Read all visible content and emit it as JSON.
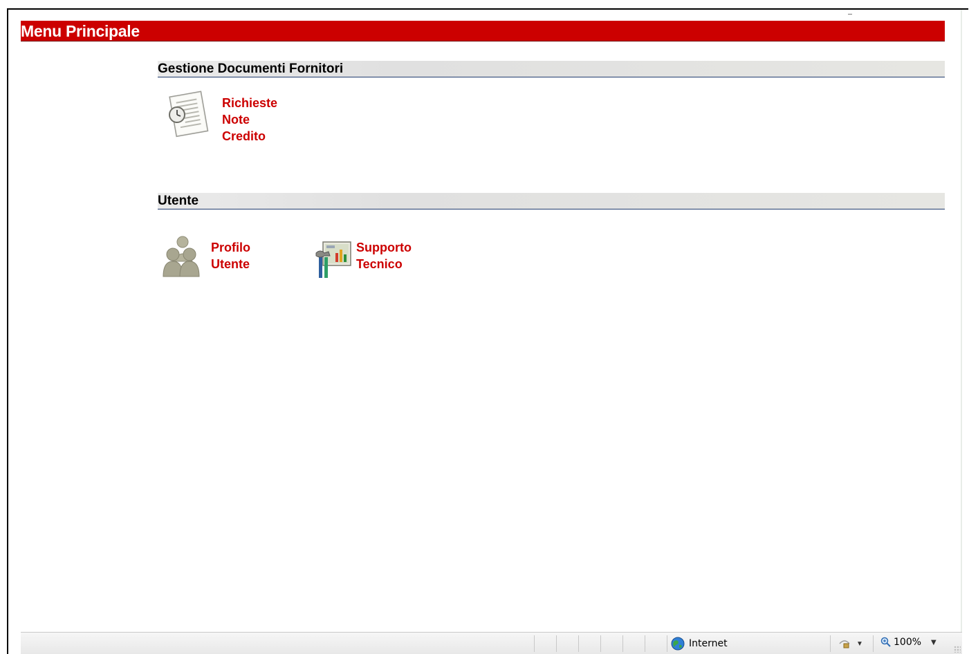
{
  "header": {
    "title": "Menu Principale"
  },
  "sections": [
    {
      "title": "Gestione Documenti Fornitori",
      "items": [
        {
          "label": "Richieste\nNote\nCredito",
          "icon": "document-clock-icon"
        }
      ]
    },
    {
      "title": "Utente",
      "items": [
        {
          "label": "Profilo\nUtente",
          "icon": "users-icon"
        },
        {
          "label": "Supporto\nTecnico",
          "icon": "tools-chart-icon"
        }
      ]
    }
  ],
  "statusbar": {
    "zone_label": "Internet",
    "zone_icon": "globe-icon",
    "protected_icon": "lock-icon",
    "zoom_label": "100%",
    "zoom_icon": "magnifier-icon"
  },
  "colors": {
    "accent": "#cc0000",
    "section_line": "#1f3a6d",
    "link": "#cc0000"
  }
}
